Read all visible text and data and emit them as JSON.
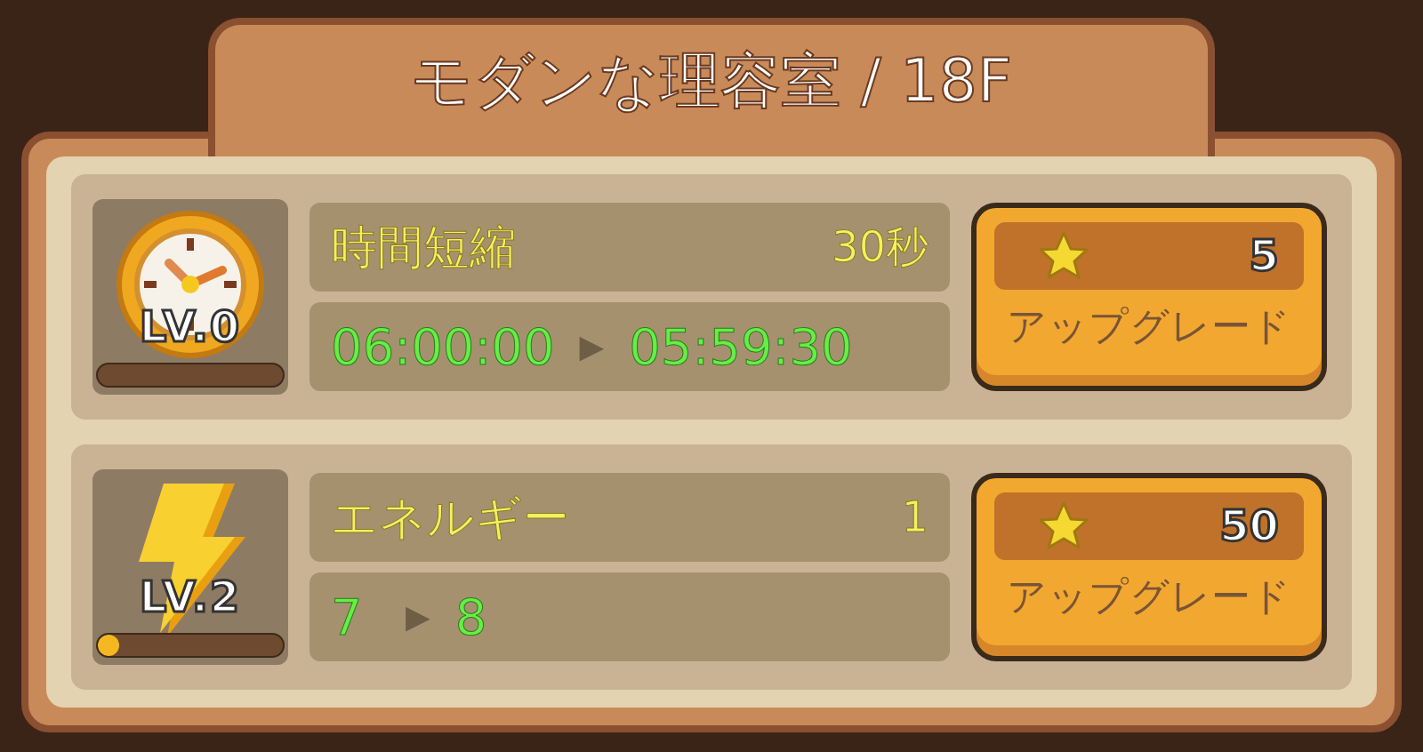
{
  "title": "モダンな理容室 / 18F",
  "upgrades": [
    {
      "kind": "clock",
      "level_label": "LV.0",
      "level": 0,
      "name": "時間短縮",
      "amount": "30秒",
      "from": "06:00:00",
      "arrow": "▶",
      "to": "05:59:30",
      "cost": "5",
      "button": "アップグレード"
    },
    {
      "kind": "energy",
      "level_label": "LV.2",
      "level": 0.12,
      "name": "エネルギー",
      "amount": "1",
      "from": "7",
      "arrow": "▶",
      "to": "8",
      "cost": "50",
      "button": "アップグレード"
    }
  ]
}
